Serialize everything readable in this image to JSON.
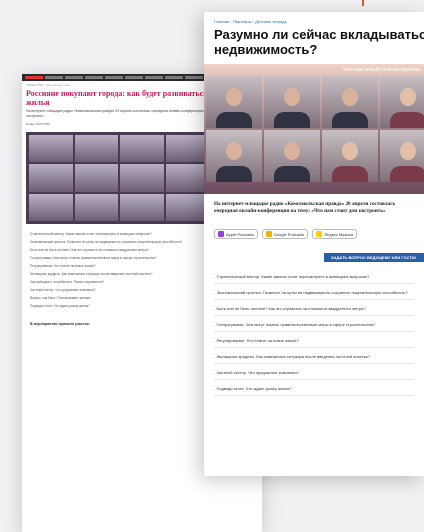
{
  "background_article": {
    "breadcrumb": "ОБЩЕСТВО · Актуальная тема",
    "title_line1": "Россияне покупают города: как будет развиваться",
    "title_line2": "жилья",
    "lead": "На интернет-площадке радио «Комсомольская правда» 20 апреля состоялась очередная онлайн-конференция на тему: «Что нам стоит дом построить»",
    "author": "Ирина ПЕТРОВА",
    "questions": [
      "Стратегический вектор. Какие законы стоит пересмотреть в жилищных вопросах?",
      "Экономический прогноз. Позволят ли цены на недвижимость сохранить покупательскую способность?",
      "Быть или не быть ипотеке? Как это отразится на стоимости квадратного метра?",
      "Госпрограммы. Чем могут помочь правительственные меры в сфере строительства?",
      "Регулирование. Кто платит за новое жильё?",
      "Жилищные кредиты. Как изменилась ситуация после введения льготной ипотеки?",
      "Застройщики и потребители. Риски сохраняются?",
      "Частный сектор. Что предлагают компании?",
      "Вопрос: как быть? Рассказывает эксперт",
      "Подводя итоги. Что ждать рынку жилья?"
    ],
    "section_heading": "В мероприятии приняли участие:"
  },
  "foreground_article": {
    "breadcrumb_parts": [
      "Главная",
      "Партнеры",
      "Деловая тетрадь"
    ],
    "breadcrumb_sep": " • ",
    "title_line1": "Разумно ли сейчас вкладываться в",
    "title_line2": "недвижимость?",
    "photo_caption": "Что нам стоит дом построить",
    "lead": "На интернет-площадке радио «Комсомольская правда» 20 апреля состоялась очередная онлайн-конференция на тему: «Что нам стоит дом построить»",
    "podcasts": [
      {
        "label": "Apple Podcasts",
        "icon": "apple-podcasts-icon",
        "color": "#9b3fd0"
      },
      {
        "label": "Google Podcasts",
        "icon": "google-podcasts-icon",
        "color": "#f2b400"
      },
      {
        "label": "Яндекс Музыка",
        "icon": "yandex-music-icon",
        "color": "#ffcc00"
      }
    ],
    "ask_button": "ЗАДАТЬ ВОПРОС ВЕДУЩЕМУ ИЛИ ГОСТЮ",
    "questions": [
      "- Стратегический вектор. Какие законы стоит пересмотреть в жилищных вопросах?",
      "- Экономический прогноз. Позволят ли цены на недвижимость сохранить покупательскую способность?",
      "- Быть или не быть ипотеке? Как это отразится на стоимости квадратного метра?",
      "- Госпрограммы. Чем могут помочь правительственные меры в сфере строительства?",
      "- Регулирование. Кто платит за новое жильё?",
      "- Жилищные кредиты. Как изменилась ситуация после введения льготной ипотеки?",
      "- Частный сектор. Что предлагают компании?",
      "- Подводя итоги. Что ждать рынку жилья?"
    ]
  },
  "colors": {
    "accent": "#e05a2b",
    "bg_title": "#c2185b",
    "link": "#2a6db0",
    "button": "#2a5fa8"
  }
}
